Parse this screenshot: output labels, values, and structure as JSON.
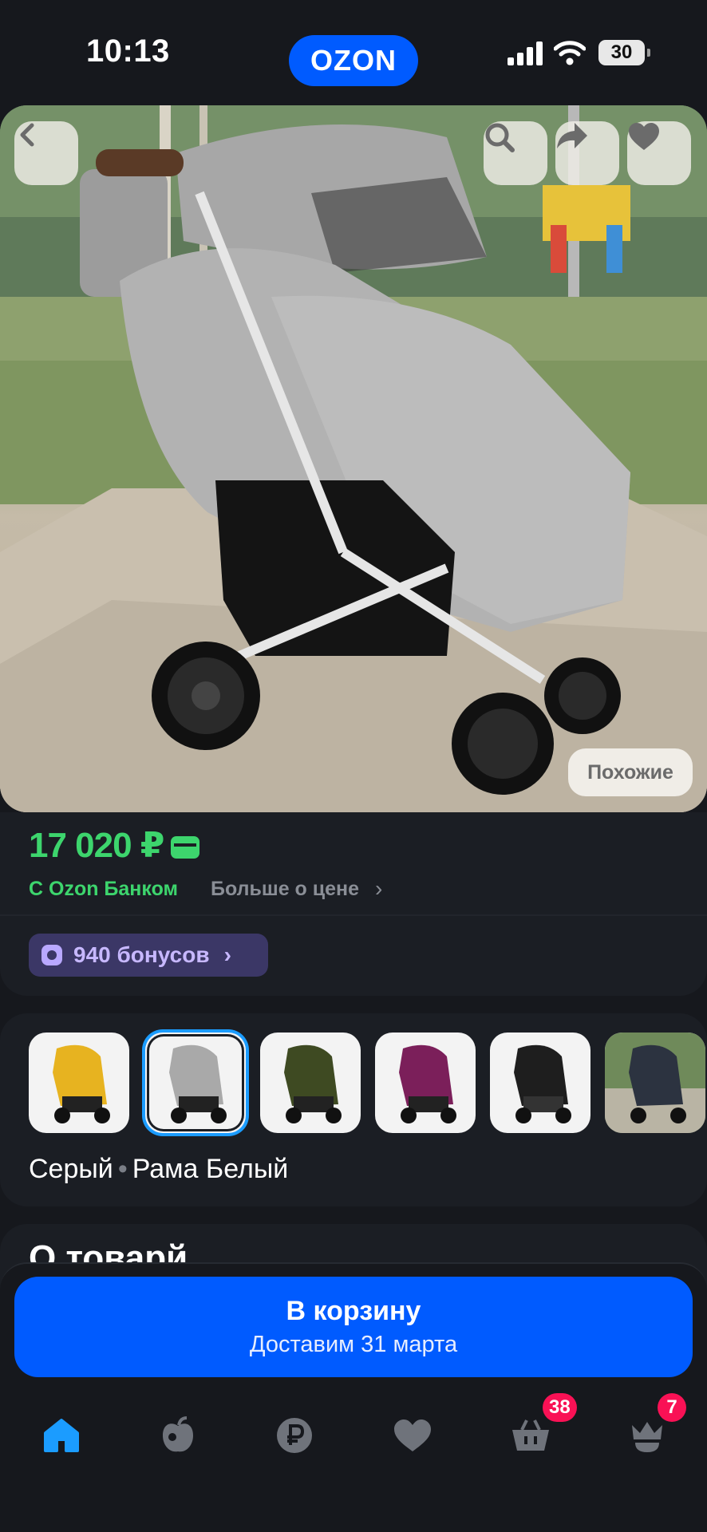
{
  "status_bar": {
    "time": "10:13",
    "logo": "OZON",
    "battery": "30"
  },
  "hero": {
    "back_icon": "chevron-left-icon",
    "actions": [
      "search-icon",
      "share-icon",
      "heart-icon"
    ],
    "similar_label": "Похожие"
  },
  "price_block": {
    "price": "17 020 ₽",
    "bank_label": "С Ozon Банком",
    "more_label": "Больше о цене",
    "bonus_label": "940 бонусов",
    "accent_color": "#3dd56d",
    "bonus_color": "#c7b8ff"
  },
  "variants": {
    "items": [
      {
        "color": "#e7b320",
        "name": "yellow"
      },
      {
        "color": "#a9a9a9",
        "name": "grey",
        "selected": true
      },
      {
        "color": "#3e4a22",
        "name": "olive"
      },
      {
        "color": "#7b1f5a",
        "name": "purple"
      },
      {
        "color": "#1e1e1e",
        "name": "black"
      },
      {
        "color": "#2c3340",
        "name": "dark-photo"
      }
    ],
    "color_name": "Серый",
    "frame_name": "Рама Белый"
  },
  "next_card": {
    "title_fragment": "О товарй"
  },
  "cart": {
    "label": "В корзину",
    "delivery": "Доставим 31 марта",
    "brand_color": "#005bff"
  },
  "nav": {
    "items": [
      {
        "icon": "home-icon",
        "active": true
      },
      {
        "icon": "fresh-apple-icon"
      },
      {
        "icon": "ruble-icon"
      },
      {
        "icon": "heart-icon"
      },
      {
        "icon": "cart-basket-icon",
        "badge": "38"
      },
      {
        "icon": "profile-crown-icon",
        "badge": "7"
      }
    ]
  }
}
